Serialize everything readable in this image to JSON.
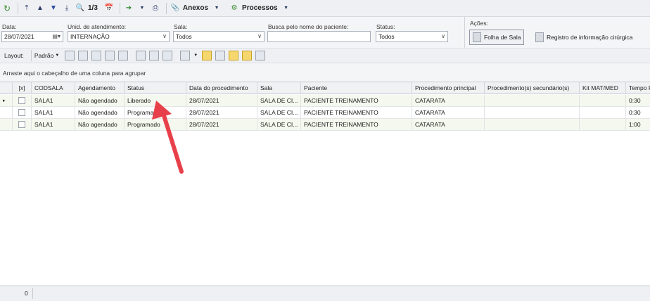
{
  "toolbar": {
    "page_counter": "1/3",
    "anexos_label": "Anexos",
    "processos_label": "Processos"
  },
  "filters": {
    "data_label": "Data:",
    "data_value": "28/07/2021",
    "unid_label": "Unid. de atendimento:",
    "unid_value": "INTERNAÇÃO",
    "sala_label": "Sala:",
    "sala_value": "Todos",
    "busca_label": "Busca pelo nome do paciente:",
    "busca_value": "",
    "status_label": "Status:",
    "status_value": "Todos"
  },
  "actions": {
    "title": "Ações:",
    "folha_label": "Folha de Sala",
    "registro_label": "Registro de informação cirúrgica"
  },
  "layoutbar": {
    "layout_label": "Layout:",
    "padrao_label": "Padrão"
  },
  "groupbar": {
    "hint": "Arraste aqui o cabeçalho de uma coluna para agrupar"
  },
  "grid": {
    "columns": [
      "[x]",
      "CODSALA",
      "Agendamento",
      "Status",
      "Data do procedimento",
      "Sala",
      "Paciente",
      "Procedimento principal",
      "Procedimento(s) secundário(s)",
      "Kit MAT/MED",
      "Tempo P"
    ],
    "rows": [
      {
        "codsala": "SALA1",
        "agendamento": "Não agendado",
        "status": "Liberado",
        "data": "28/07/2021",
        "sala": "SALA DE CI...",
        "paciente": "PACIENTE TREINAMENTO",
        "proc_principal": "CATARATA",
        "proc_sec": "",
        "kit": "",
        "tempo": "0:30"
      },
      {
        "codsala": "SALA1",
        "agendamento": "Não agendado",
        "status": "Programado",
        "data": "28/07/2021",
        "sala": "SALA DE CI...",
        "paciente": "PACIENTE TREINAMENTO",
        "proc_principal": "CATARATA",
        "proc_sec": "",
        "kit": "",
        "tempo": "0:30"
      },
      {
        "codsala": "SALA1",
        "agendamento": "Não agendado",
        "status": "Programado",
        "data": "28/07/2021",
        "sala": "SALA DE CI...",
        "paciente": "PACIENTE TREINAMENTO",
        "proc_principal": "CATARATA",
        "proc_sec": "",
        "kit": "",
        "tempo": "1:00"
      }
    ]
  },
  "statusbar": {
    "count": "0"
  },
  "colors": {
    "annotation_arrow": "#e8404a",
    "row_alt": "#f5f8ee"
  }
}
